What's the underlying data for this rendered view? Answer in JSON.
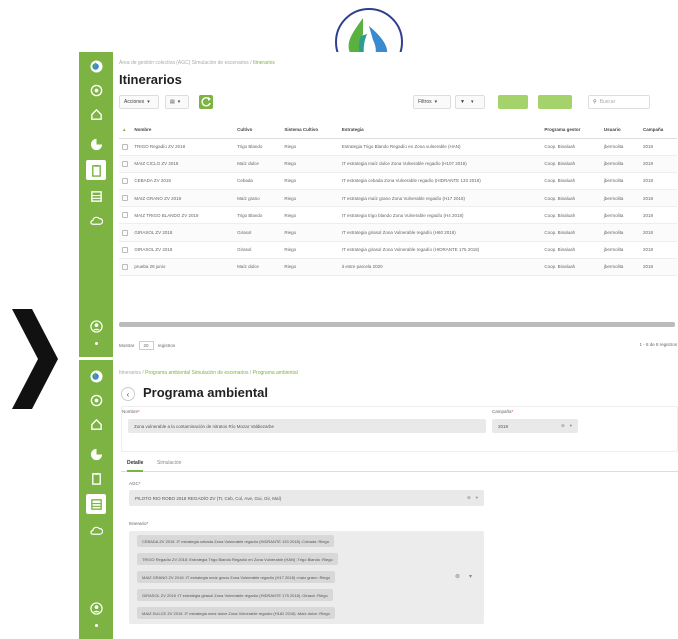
{
  "colors": {
    "sidebar": "#7cb342",
    "accent": "#7cb342"
  },
  "top": {
    "breadcrumb_root": "Área de gestión colectiva (AGC) Simulación de escenarios",
    "breadcrumb_sep": "/",
    "breadcrumb_current": "Itinerarios",
    "title": "Itinerarios",
    "actions_label": "Acciones",
    "filters_label": "Filtros",
    "search_placeholder": "Buscar",
    "columns": [
      "Nombre",
      "Cultivo",
      "Sistema Cultivo",
      "Estrategia",
      "Programa gestor",
      "Usuario",
      "Campaña"
    ],
    "rows": [
      [
        "TRIGO Regadío ZV 2018",
        "Trigo Blando",
        "Riego",
        "Estrategia Trigo Blando Regadío en Zona vulnerable (HAN)",
        "Coop. Binaluah",
        "jbermolita",
        "2018"
      ],
      [
        "MAIZ CICLO ZV 2018",
        "Maíz dulce",
        "Riego",
        "IT estrategia maíz dulce Zona Vulnerable regadío (H107 2018)",
        "Coop. Binaluah",
        "jbermolita",
        "2018"
      ],
      [
        "CEBADA ZV 2018",
        "Cebada",
        "Riego",
        "IT estrategia cebada Zona Vulnerable regadío (HIDRANTE 133 2018)",
        "Coop. Binaluah",
        "jbermolita",
        "2018"
      ],
      [
        "MAIZ GRANO ZV 2018",
        "Maíz grano",
        "Riego",
        "IT estrategia maíz grano Zona Vulnerable regadío (H17 2018)",
        "Coop. Binaluah",
        "jbermolita",
        "2018"
      ],
      [
        "MAIZ TRIGO BLANDO ZV 2018",
        "Trigo Blando",
        "Riego",
        "IT estrategia trigo blando Zona Vulnerable regadío (H4 2018)",
        "Coop. Binaluah",
        "jbermolita",
        "2018"
      ],
      [
        "GIRASOL ZV 2018",
        "Girasol",
        "Riego",
        "IT estrategia girasol Zona Vulnerable regadío (H60 2018)",
        "Coop. Binaluah",
        "jbermolita",
        "2018"
      ],
      [
        "GIRASOL ZV 2018",
        "Girasol",
        "Riego",
        "IT estrategia girasol Zona Vulnerable regadío (HIDRANTE 175 2018)",
        "Coop. Binaluah",
        "jbermolita",
        "2018"
      ],
      [
        "prueba 28 junio",
        "Maíz dulce",
        "Riego",
        "it estre parcela 2020",
        "Coop. Binaluah",
        "jbermolita",
        "2018"
      ]
    ],
    "show_label": "Mostrar",
    "show_value": "20",
    "records_label": "registros",
    "pagination_info": "1 - 8 de 8 registros"
  },
  "bottom": {
    "breadcrumb_root": "Itinerarios",
    "breadcrumb_sep": "/",
    "breadcrumb_mid": "Programa ambiental Simulación de escenarios",
    "breadcrumb_current": "Programa ambiental",
    "back_glyph": "‹",
    "title": "Programa ambiental",
    "name_label": "Nombre",
    "name_value": "Zona vulnerable a la contaminación de nitratos Río Mozar Valdiezarbe",
    "campaign_label": "Campaña",
    "campaign_value": "2018",
    "tab_detail": "Detalle",
    "tab_simulation": "Simulación",
    "agc_label": "AGC",
    "agc_value": "PILOTO RIO ROBO 2018 REGADÍO ZV (Tr, Ceb, Col, Ave, Gui, Gir, Maí)",
    "itinerary_label": "Itinerario",
    "itineraries": [
      "CEBADA ZV 2018 :IT estrategia cebada Zona Vulnerable regadío (HIDRANTE 133 2018) :Cebada :Riego",
      "TRIGO Regadío ZV 2018 :Estrategia Trigo Blando Regadío en Zona Vulnerable (HAN) :Trigo Blando :Riego",
      "MAIZ GRANO ZV 2018 :IT estrategia maíz grano Zona Vulnerable regadío (H17 2018) :maíz grano :Riego",
      "GIRASOL ZV 2018 :IT estrategia girasol Zona Vulnerable regadío (HIDRANTE 175 2018) :Girasol :Riego",
      "MAIZ DULCE ZV 2018 :IT estrategia maíz dulce Zona Vulnerable regadío (H182 2018) :Maíz dulce :Riego"
    ]
  },
  "icons": [
    "app-logo-icon",
    "chevron-right-icon",
    "home-icon",
    "pie-chart-icon",
    "clipboard-icon",
    "database-icon",
    "cloud-icon",
    "user-circle-icon"
  ]
}
